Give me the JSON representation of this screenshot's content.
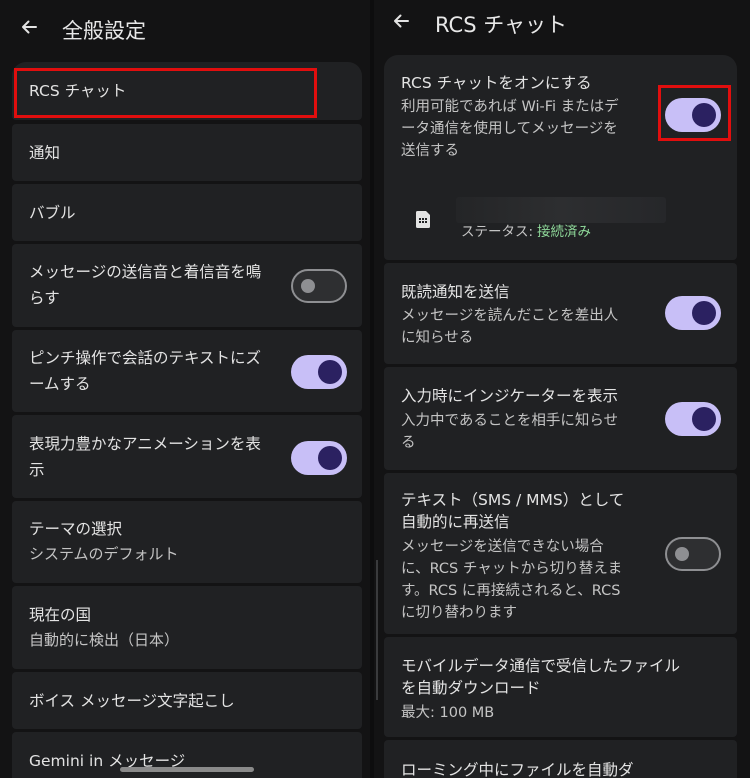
{
  "left": {
    "title": "全般設定",
    "items": [
      {
        "label": "RCS チャット"
      },
      {
        "label": "通知"
      },
      {
        "label": "バブル"
      },
      {
        "label1": "メッセージの送信音と着信音を鳴",
        "label2": "らす",
        "toggle": "off"
      },
      {
        "label1": "ピンチ操作で会話のテキストにズ",
        "label2": "ームする",
        "toggle": "on"
      },
      {
        "label1": "表現力豊かなアニメーションを表",
        "label2": "示",
        "toggle": "on"
      },
      {
        "label": "テーマの選択",
        "sub": "システムのデフォルト"
      },
      {
        "label": "現在の国",
        "sub": "自動的に検出（日本）"
      },
      {
        "label": "ボイス メッセージ文字起こし"
      },
      {
        "label": "Gemini in メッセージ"
      }
    ]
  },
  "right": {
    "title": "RCS チャット",
    "rcs_toggle": {
      "label": "RCS チャットをオンにする",
      "sub1": "利用可能であれば Wi-Fi またはデ",
      "sub2": "ータ通信を使用してメッセージを",
      "sub3": "送信する",
      "state": "on"
    },
    "status": {
      "prefix": "ステータス: ",
      "value": "接続済み",
      "icon": "sim-card-icon"
    },
    "read_receipts": {
      "label": "既読通知を送信",
      "sub1": "メッセージを読んだことを差出人",
      "sub2": "に知らせる",
      "state": "on"
    },
    "typing": {
      "label": "入力時にインジケーターを表示",
      "sub1": "入力中であることを相手に知らせ",
      "sub2": "る",
      "state": "on"
    },
    "resend": {
      "label1": "テキスト（SMS / MMS）として",
      "label2": "自動的に再送信",
      "sub1": "メッセージを送信できない場合",
      "sub2": "に、RCS チャットから切り替えま",
      "sub3": "す。RCS に再接続されると、RCS",
      "sub4": "に切り替わります",
      "state": "off"
    },
    "auto_download": {
      "label1": "モバイルデータ通信で受信したファイル",
      "label2": "を自動ダウンロード",
      "sub": "最大: 100 MB"
    },
    "roaming": {
      "label": "ローミング中にファイルを自動ダ"
    }
  },
  "colors": {
    "accent_track": "#c8bff7",
    "accent_knob": "#2b2161",
    "card_bg": "#202123",
    "page_bg": "#131314",
    "status_green": "#8fd99a",
    "highlight_red": "#e10e0e"
  }
}
